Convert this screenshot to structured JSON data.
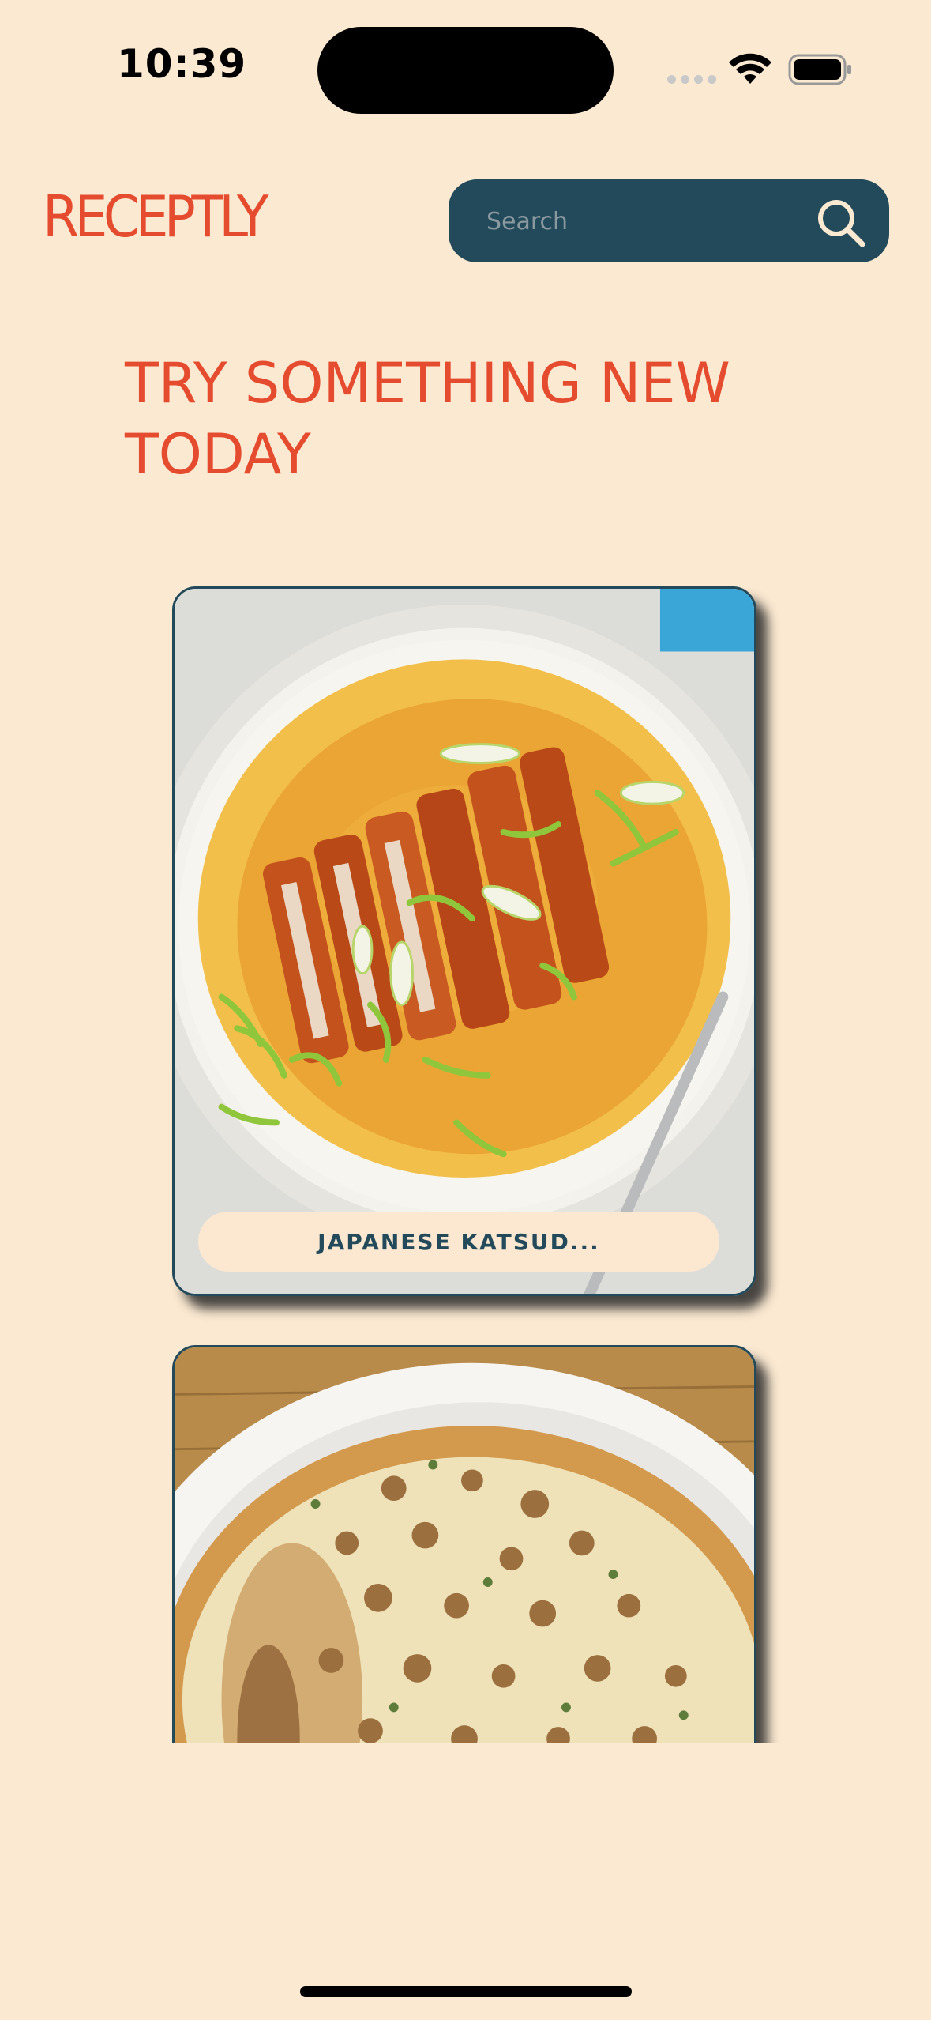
{
  "status_bar": {
    "time": "10:39"
  },
  "header": {
    "logo": "RECEPTLY",
    "search": {
      "placeholder": "Search",
      "value": "",
      "icon": "search-icon"
    }
  },
  "main": {
    "title": "TRY SOMETHING NEW TODAY",
    "recipes": [
      {
        "label": "JAPANESE KATSUD...",
        "image": "katsudon-bowl-photo"
      },
      {
        "label": "",
        "image": "walnut-cheesecake-photo"
      }
    ]
  },
  "colors": {
    "background": "#fbe9d1",
    "accent": "#e44b2f",
    "primary": "#224a5b",
    "label_bg": "#fce8d1"
  }
}
